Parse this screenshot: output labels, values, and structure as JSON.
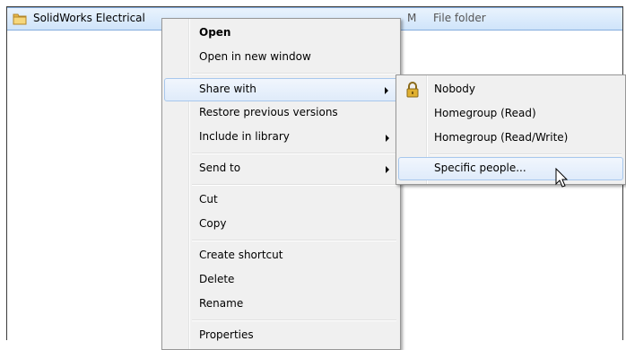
{
  "file_list": {
    "row": {
      "name": "SolidWorks Electrical",
      "modified_suffix": "M",
      "type": "File folder"
    }
  },
  "context_menu": {
    "items": [
      {
        "label": "Open"
      },
      {
        "label": "Open in new window"
      },
      {
        "label": "Share with"
      },
      {
        "label": "Restore previous versions"
      },
      {
        "label": "Include in library"
      },
      {
        "label": "Send to"
      },
      {
        "label": "Cut"
      },
      {
        "label": "Copy"
      },
      {
        "label": "Create shortcut"
      },
      {
        "label": "Delete"
      },
      {
        "label": "Rename"
      },
      {
        "label": "Properties"
      }
    ]
  },
  "share_submenu": {
    "items": [
      {
        "label": "Nobody",
        "icon": "lock-icon"
      },
      {
        "label": "Homegroup (Read)"
      },
      {
        "label": "Homegroup (Read/Write)"
      },
      {
        "label": "Specific people..."
      }
    ]
  },
  "colors": {
    "selection_fill": "#cfe4fa",
    "selection_border": "#84acdd",
    "menu_background": "#f0f0f0",
    "folder_yellow": "#f2c55c",
    "lock_gold": "#d4a017"
  }
}
